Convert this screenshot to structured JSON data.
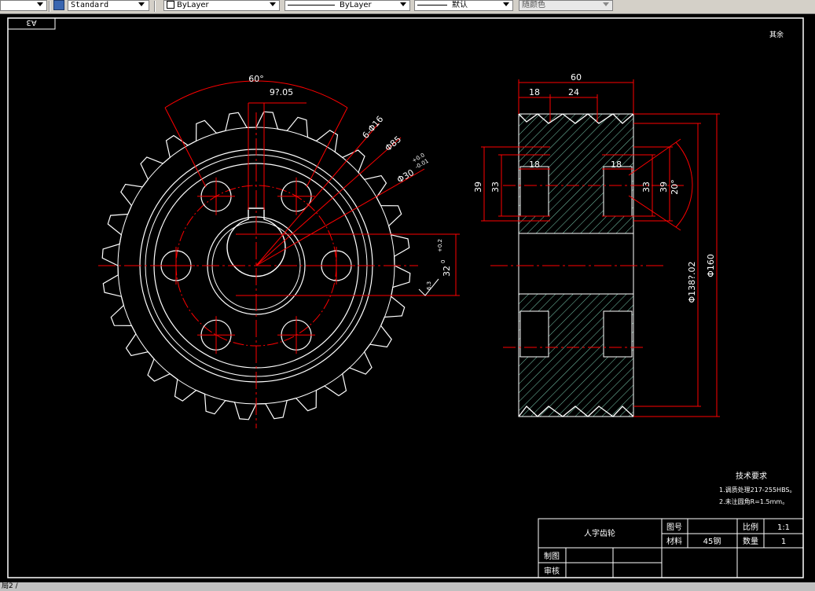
{
  "toolbar": {
    "text_style": "Standard",
    "layer": "ByLayer",
    "linetype": "ByLayer",
    "lineweight": "默认",
    "plot_style": "随颜色"
  },
  "sheet": {
    "size_label": "A3",
    "corner_note": "其余"
  },
  "dims": {
    "front_angle": "60°",
    "key_width": "9?.05",
    "holes": "6-Φ16",
    "pcd": "Φ85",
    "bore": "Φ30",
    "bore_tol_upper": "+0.0",
    "bore_tol_lower": "-0.01",
    "keyway": "32",
    "keyway_tol": "+0.2",
    "keyway_tol2": "0",
    "surface": "6.3",
    "total_width": "60",
    "groove_18": "18",
    "groove_24": "24",
    "side_39": "39",
    "side_33": "33",
    "inner_18_left": "18",
    "inner_18_right": "18",
    "right_33": "33",
    "right_39": "39",
    "angle_20": "20°",
    "root_dia": "Φ138?.02",
    "outer_dia": "Φ160"
  },
  "notes": {
    "title": "技术要求",
    "line1": "1.调质处理217-255HBS。",
    "line2": "2.未注圆角R=1.5mm。"
  },
  "title_block": {
    "part_name": "人字齿轮",
    "drawing_no_label": "图号",
    "scale_label": "比例",
    "scale_value": "1:1",
    "material_label": "材料",
    "material_value": "45钢",
    "qty_label": "数量",
    "qty_value": "1",
    "drawn_label": "制图",
    "checked_label": "审核"
  },
  "status": {
    "text": "局2 /"
  }
}
